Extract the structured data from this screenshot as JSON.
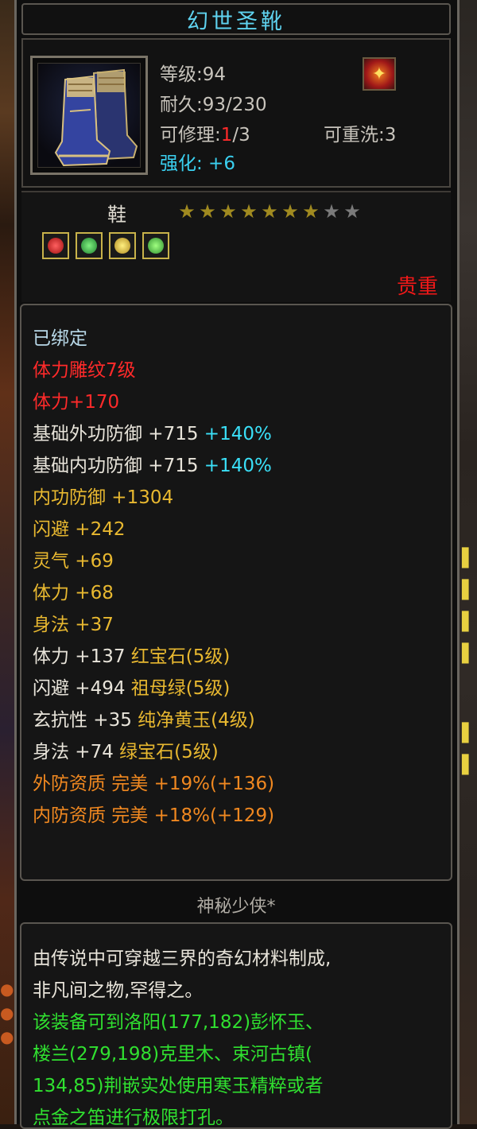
{
  "item": {
    "name": "幻世圣靴",
    "level_label": "等级:94",
    "durability_label": "耐久:93/230",
    "repair_prefix": "可修理:",
    "repair_current": "1",
    "repair_suffix": "/3",
    "rewash_label": "可重洗:3",
    "enhance_label": "强化: +6",
    "type": "鞋",
    "stars_total": 9,
    "stars_filled": 7,
    "rarity": "贵重",
    "gems": [
      {
        "icon": "ruby-gem-icon",
        "color": "#d02020"
      },
      {
        "icon": "emerald-gem-icon",
        "color": "#30b040"
      },
      {
        "icon": "topaz-gem-icon",
        "color": "#d8b030"
      },
      {
        "icon": "green-gem-icon",
        "color": "#40c040"
      }
    ]
  },
  "attributes": [
    {
      "text": "已绑定",
      "color": "bound"
    },
    {
      "text": "体力雕纹7级",
      "color": "red"
    },
    {
      "text": "体力+170",
      "color": "red"
    },
    {
      "text": "基础外功防御 +715 ",
      "extra": "+140%",
      "color": "white"
    },
    {
      "text": "基础内功防御 +715 ",
      "extra": "+140%",
      "color": "white"
    },
    {
      "text": "内功防御 +1304",
      "color": "gold"
    },
    {
      "text": "闪避 +242",
      "color": "gold"
    },
    {
      "text": "灵气 +69",
      "color": "gold"
    },
    {
      "text": "体力 +68",
      "color": "gold"
    },
    {
      "text": "身法 +37",
      "color": "gold"
    },
    {
      "text": "体力 +137 ",
      "extra": "红宝石(5级)",
      "color": "white",
      "extra_color": "gold"
    },
    {
      "text": "闪避 +494 ",
      "extra": "祖母绿(5级)",
      "color": "white",
      "extra_color": "gold"
    },
    {
      "text": "玄抗性 +35 ",
      "extra": "纯净黄玉(4级)",
      "color": "white",
      "extra_color": "gold"
    },
    {
      "text": "身法 +74 ",
      "extra": "绿宝石(5级)",
      "color": "white",
      "extra_color": "gold"
    },
    {
      "text": "外防资质  完美 +19%(+136)",
      "color": "orange"
    },
    {
      "text": "内防资质  完美 +18%(+129)",
      "color": "orange"
    }
  ],
  "maker": "神秘少侠*",
  "description": [
    {
      "text": "由传说中可穿越三界的奇幻材料制成,",
      "color": "desc"
    },
    {
      "text": "非凡间之物,罕得之。",
      "color": "desc"
    },
    {
      "text": "该装备可到洛阳(177,182)彭怀玉、",
      "color": "green"
    },
    {
      "text": "楼兰(279,198)克里木、束河古镇(",
      "color": "green"
    },
    {
      "text": "134,85)荆嵌实处使用寒玉精粹或者",
      "color": "green"
    },
    {
      "text": "点金之笛进行极限打孔。",
      "color": "green"
    }
  ],
  "colors": {
    "title": "#5fd3f0",
    "rarity": "#f01818",
    "enhance": "#3ad0f0"
  }
}
